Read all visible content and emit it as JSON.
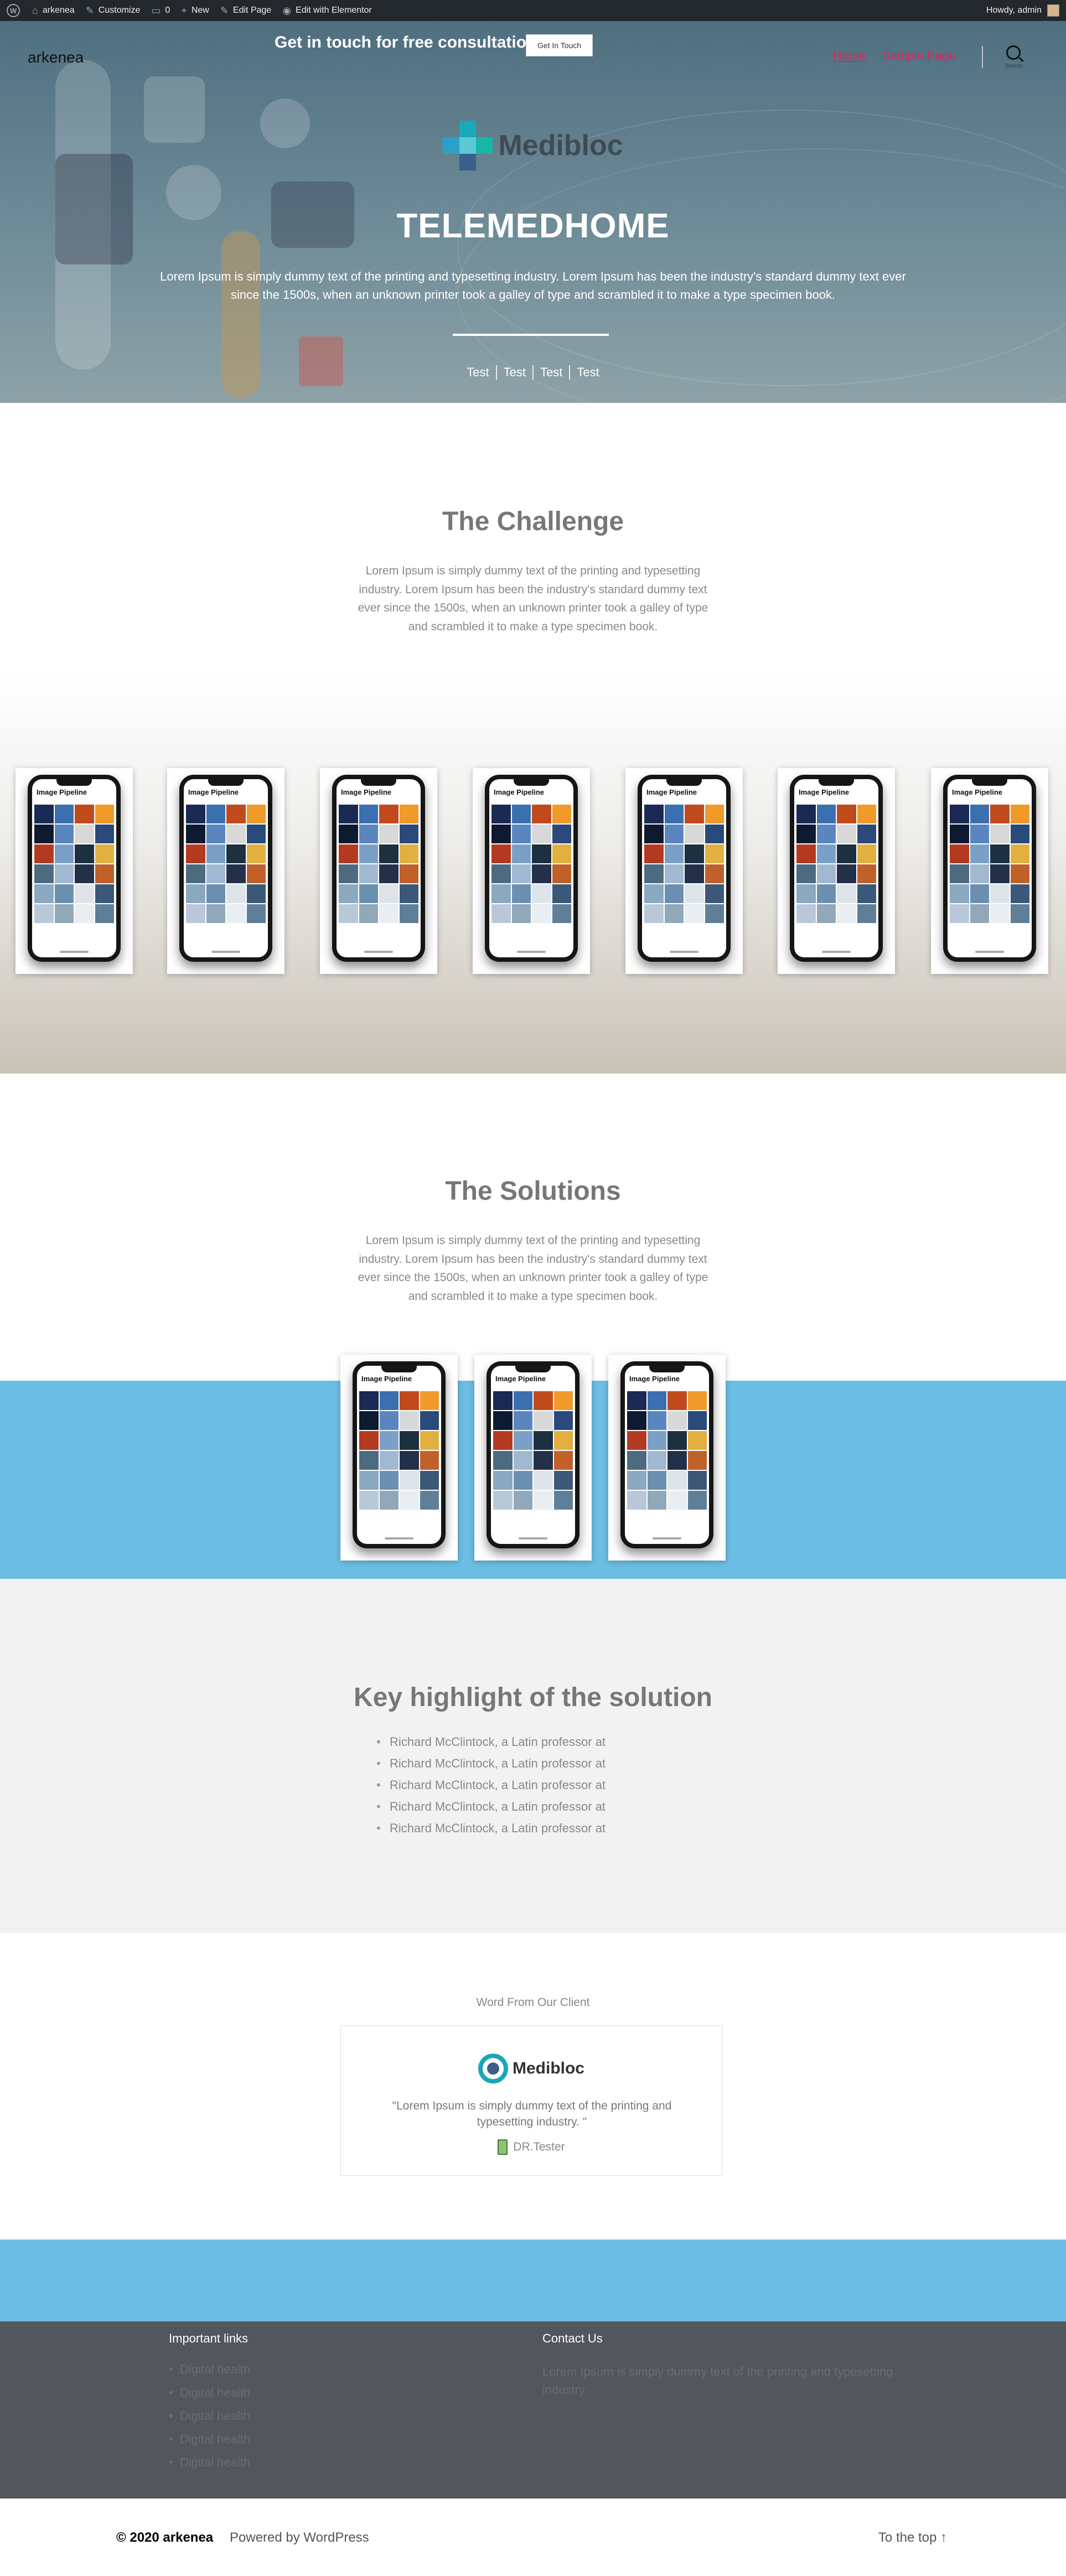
{
  "adminbar": {
    "site_name": "arkenea",
    "customize": "Customize",
    "comments_count": "0",
    "new": "New",
    "edit_page": "Edit Page",
    "edit_elementor": "Edit with Elementor",
    "howdy": "Howdy, admin"
  },
  "header": {
    "brand": "arkenea",
    "nav": [
      "Home",
      "Sample Page"
    ],
    "search_label": "Search"
  },
  "hero": {
    "logo_text": "Medibloc",
    "title": "TELEMEDHOME",
    "subtitle": "Lorem Ipsum is simply dummy text of the printing and typesetting industry. Lorem Ipsum has been the industry's standard dummy text ever since the 1500s, when an unknown printer took a galley of type and scrambled it to make a type specimen book.",
    "tags": [
      "Test",
      "Test",
      "Test",
      "Test"
    ]
  },
  "challenge": {
    "title": "The Challenge",
    "text": "Lorem Ipsum is simply dummy text of the printing and typesetting industry. Lorem Ipsum has been the industry's standard dummy text ever since the 1500s, when an unknown printer took a galley of type and scrambled it to make a type specimen book.",
    "screen_title": "Image Pipeline"
  },
  "solutions": {
    "title": "The Solutions",
    "text": "Lorem Ipsum is simply dummy text of the printing and typesetting industry. Lorem Ipsum has been the industry's standard dummy text ever since the 1500s, when an unknown printer took a galley of type and scrambled it to make a type specimen book.",
    "screen_title": "Image Pipeline"
  },
  "highlights": {
    "title": "Key highlight of the solution",
    "items": [
      "Richard McClintock, a Latin professor at",
      "Richard McClintock, a Latin professor at",
      "Richard McClintock, a Latin professor at",
      "Richard McClintock, a Latin professor at",
      "Richard McClintock, a Latin professor at"
    ]
  },
  "testimonial": {
    "heading": "Word From Our Client",
    "logo_text": "Medibloc",
    "quote": "\"Lorem Ipsum is simply dummy text of the printing and typesetting industry. \"",
    "author": "DR.Tester"
  },
  "cta": {
    "text": "Get in touch for free consultation",
    "button": "Get In Touch"
  },
  "footer_widgets": {
    "links_title": "Important links",
    "links": [
      "Digital health",
      "Digital health",
      "Digital health",
      "Digital health",
      "Digital health"
    ],
    "contact_title": "Contact Us",
    "contact_text": "Lorem Ipsum is simply dummy text of the printing and typesetting industry."
  },
  "footer": {
    "copyright": "© 2020 arkenea",
    "powered": "Powered by WordPress",
    "to_top": "To the top ↑"
  },
  "colors": {
    "accent": "#e0245e",
    "band_blue": "#6bbde3",
    "footer_dark": "#54565e"
  }
}
